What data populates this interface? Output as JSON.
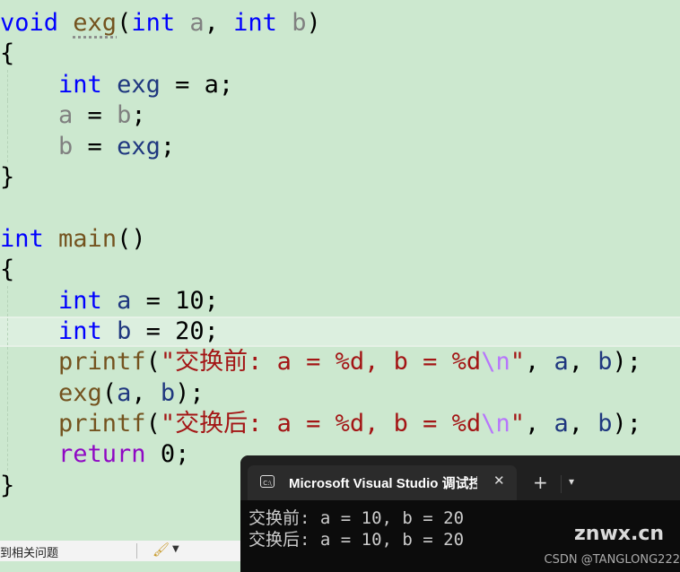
{
  "editor": {
    "lines": [
      [
        [
          "kw",
          "void"
        ],
        [
          "pl",
          " "
        ],
        [
          "fn dot",
          "exg"
        ],
        [
          "pl",
          "("
        ],
        [
          "kw",
          "int"
        ],
        [
          "pl",
          " "
        ],
        [
          "pa",
          "a"
        ],
        [
          "pl",
          ", "
        ],
        [
          "kw",
          "int"
        ],
        [
          "pl",
          " "
        ],
        [
          "pa",
          "b"
        ],
        [
          "pl",
          ")"
        ]
      ],
      [
        [
          "pl",
          "{"
        ]
      ],
      [
        [
          "pl",
          "    "
        ],
        [
          "kw",
          "int"
        ],
        [
          "pl",
          " "
        ],
        [
          "lo",
          "exg"
        ],
        [
          "pl",
          " = a;"
        ]
      ],
      [
        [
          "pl",
          "    "
        ],
        [
          "pa",
          "a"
        ],
        [
          "pl",
          " = "
        ],
        [
          "pa",
          "b"
        ],
        [
          "pl",
          ";"
        ]
      ],
      [
        [
          "pl",
          "    "
        ],
        [
          "pa",
          "b"
        ],
        [
          "pl",
          " = "
        ],
        [
          "lo",
          "exg"
        ],
        [
          "pl",
          ";"
        ]
      ],
      [
        [
          "pl",
          "}"
        ]
      ],
      [],
      [
        [
          "kw",
          "int"
        ],
        [
          "pl",
          " "
        ],
        [
          "fn",
          "main"
        ],
        [
          "pl",
          "()"
        ]
      ],
      [
        [
          "pl",
          "{"
        ]
      ],
      [
        [
          "pl",
          "    "
        ],
        [
          "kw",
          "int"
        ],
        [
          "pl",
          " "
        ],
        [
          "lo",
          "a"
        ],
        [
          "pl",
          " = 10;"
        ]
      ],
      [
        [
          "pl",
          "    "
        ],
        [
          "kw",
          "int"
        ],
        [
          "pl",
          " "
        ],
        [
          "lo",
          "b"
        ],
        [
          "pl",
          " = 20;"
        ]
      ],
      [
        [
          "pl",
          "    "
        ],
        [
          "fn",
          "printf"
        ],
        [
          "pl",
          "("
        ],
        [
          "st",
          "\"交换前: a = %d, b = %d"
        ],
        [
          "es",
          "\\n"
        ],
        [
          "st",
          "\""
        ],
        [
          "pl",
          ", "
        ],
        [
          "lo",
          "a"
        ],
        [
          "pl",
          ", "
        ],
        [
          "lo",
          "b"
        ],
        [
          "pl",
          ");"
        ]
      ],
      [
        [
          "pl",
          "    "
        ],
        [
          "fn",
          "exg"
        ],
        [
          "pl",
          "("
        ],
        [
          "lo",
          "a"
        ],
        [
          "pl",
          ", "
        ],
        [
          "lo",
          "b"
        ],
        [
          "pl",
          ");"
        ]
      ],
      [
        [
          "pl",
          "    "
        ],
        [
          "fn",
          "printf"
        ],
        [
          "pl",
          "("
        ],
        [
          "st",
          "\"交换后: a = %d, b = %d"
        ],
        [
          "es",
          "\\n"
        ],
        [
          "st",
          "\""
        ],
        [
          "pl",
          ", "
        ],
        [
          "lo",
          "a"
        ],
        [
          "pl",
          ", "
        ],
        [
          "lo",
          "b"
        ],
        [
          "pl",
          ");"
        ]
      ],
      [
        [
          "pl",
          "    "
        ],
        [
          "ct",
          "return"
        ],
        [
          "pl",
          " 0;"
        ]
      ],
      [
        [
          "pl",
          "}"
        ]
      ]
    ],
    "current_line": 10
  },
  "status": {
    "text": "到相关问题",
    "brush_icon": "brush-icon"
  },
  "terminal": {
    "tab_title": "Microsoft Visual Studio 调试控制台",
    "tab_icon": "C:\\",
    "close": "✕",
    "new_tab": "+",
    "dropdown": "⌄",
    "output": [
      "交换前: a = 10, b = 20",
      "交换后: a = 10, b = 20"
    ]
  },
  "watermark": {
    "csdn": "CSDN @TANGLONG222",
    "site": "znwx.cn"
  }
}
